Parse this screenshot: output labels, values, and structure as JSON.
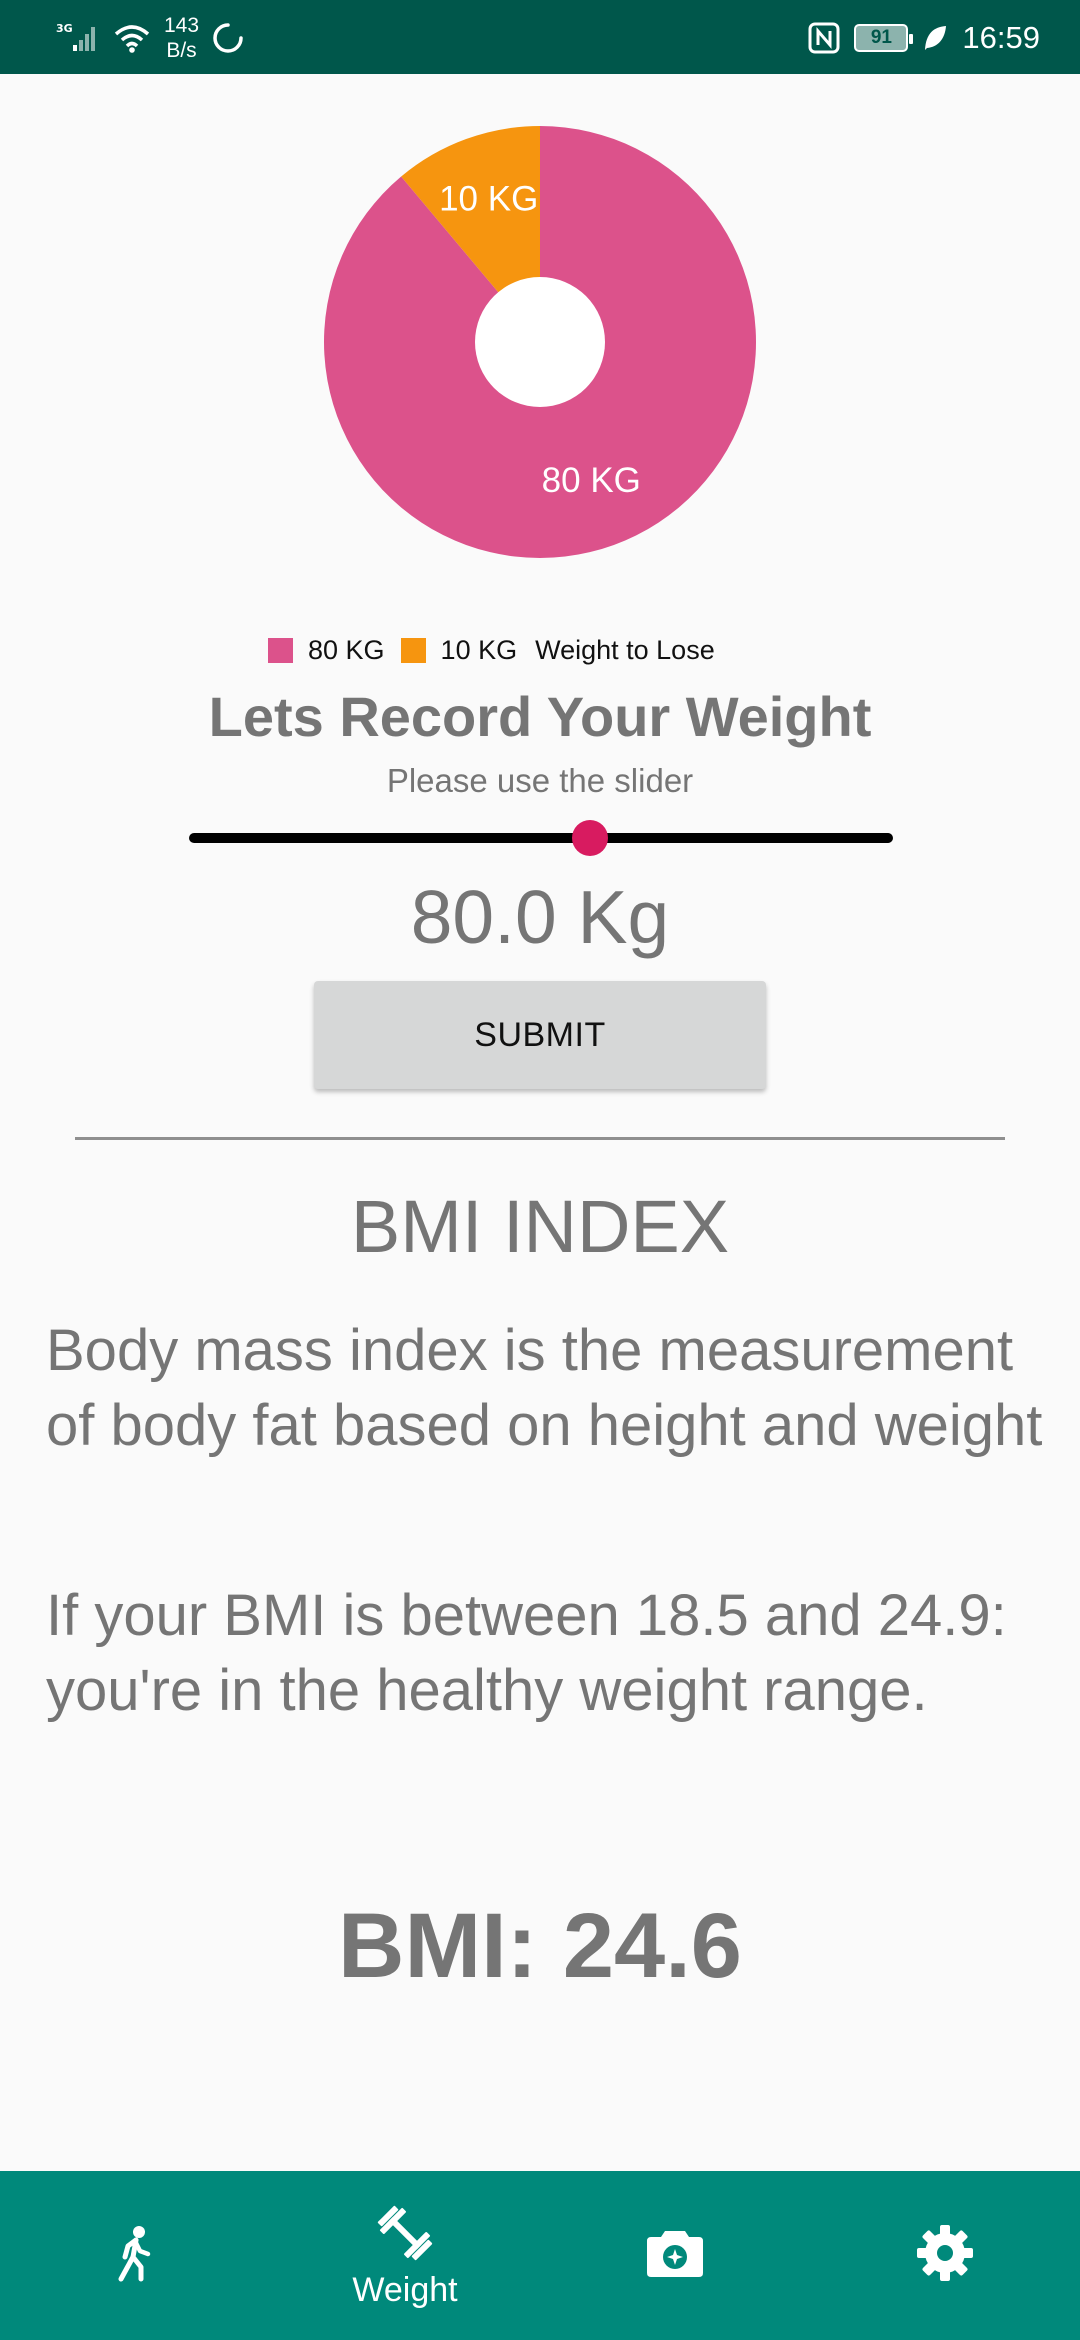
{
  "status_bar": {
    "network": "3G",
    "speed_value": "143",
    "speed_unit": "B/s",
    "battery": "91",
    "time": "16:59"
  },
  "chart_data": {
    "type": "pie",
    "hole": true,
    "slices": [
      {
        "label": "80 KG",
        "value": 80,
        "color": "#dc528b"
      },
      {
        "label": "10 KG",
        "value": 10,
        "color": "#f6950f"
      }
    ],
    "legend": {
      "entries": [
        "80 KG",
        "10 KG"
      ],
      "title": "Weight to Lose",
      "placement": "bottom-center"
    }
  },
  "main": {
    "heading": "Lets Record Your Weight",
    "subheading": "Please use the slider",
    "slider_fraction": 0.57,
    "weight_display": "80.0 Kg",
    "submit_label": "SUBMIT",
    "bmi_title": "BMI INDEX",
    "description": "Body mass index is the measurement of body fat based on height and weight",
    "healthy_range": "If your BMI is between 18.5 and 24.9: you're in the healthy weight range.",
    "bmi_value": "BMI: 24.6"
  },
  "bottom_nav": {
    "items": [
      {
        "icon": "walk-icon",
        "label": ""
      },
      {
        "icon": "dumbbell-icon",
        "label": "Weight"
      },
      {
        "icon": "camera-icon",
        "label": ""
      },
      {
        "icon": "settings-icon",
        "label": ""
      }
    ]
  },
  "colors": {
    "status_bar": "#00574b",
    "nav_bar": "#00897b",
    "accent": "#d81b60",
    "text_gray": "#757575"
  }
}
